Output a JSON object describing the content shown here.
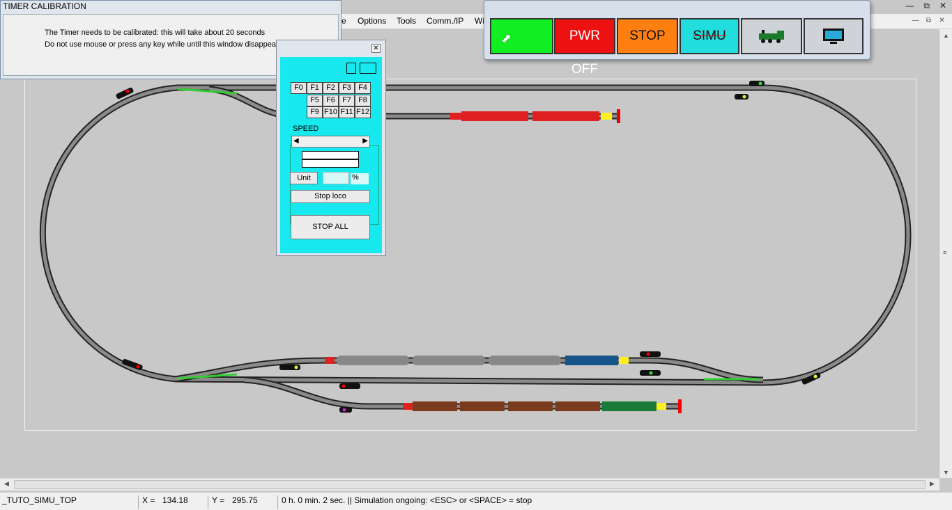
{
  "dialog": {
    "title": "TIMER CALIBRATION",
    "line1": "The Timer needs to be calibrated: this will take about 20 seconds",
    "line2": "Do not use mouse or press any key while until this window disappears"
  },
  "menu": [
    "e",
    "Options",
    "Tools",
    "Comm./IP",
    "Wi"
  ],
  "toolbar": {
    "pwr_off": "PWR OFF",
    "stop": "STOP",
    "simu": "SIMU",
    "colors": {
      "go": "#11ee22",
      "pwr": "#ee1111",
      "stop": "#ff7f11",
      "simu": "#22dddd"
    }
  },
  "cab": {
    "fkeys": [
      "F0",
      "F1",
      "F2",
      "F3",
      "F4",
      "F5",
      "F6",
      "F7",
      "F8",
      "F9",
      "F10",
      "F11",
      "F12"
    ],
    "speed_label": "SPEED",
    "unit_label": "Unit",
    "percent": "%",
    "stop_loco": "Stop loco",
    "stop_all": "STOP ALL"
  },
  "status": {
    "layout_name": "_TUTO_SIMU_TOP",
    "x_label": "X =",
    "x_value": "134.18",
    "y_label": "Y =",
    "y_value": "295.75",
    "message": "0 h. 0 min. 2 sec.  || Simulation ongoing: <ESC> or <SPACE> = stop"
  }
}
